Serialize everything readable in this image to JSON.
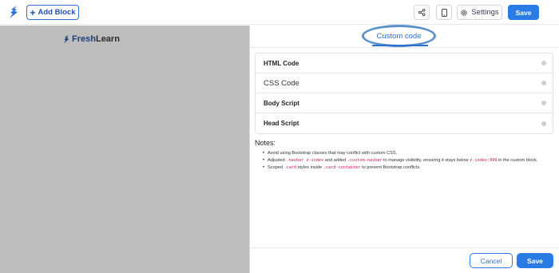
{
  "topbar": {
    "logo_icon": "freshlearn-logo-icon",
    "add_block_label": "Add Block",
    "share_icon": "share-icon",
    "mobile_icon": "mobile-icon",
    "settings_label": "Settings",
    "settings_icon": "gear-icon",
    "save_label": "Save"
  },
  "preview": {
    "brand_fresh": "Fresh",
    "brand_learn": "Learn"
  },
  "panel": {
    "title": "Custom code",
    "sections": [
      {
        "label": "HTML Code"
      },
      {
        "label": "CSS Code"
      },
      {
        "label": "Body Script"
      },
      {
        "label": "Head Script"
      }
    ],
    "notes_title": "Notes:",
    "notes": {
      "n1": "Avoid using Bootstrap classes that may conflict with custom CSS.",
      "n2_a": "Adjusted ",
      "n2_code1": ".navbar z-index",
      "n2_b": " and added ",
      "n2_code2": ".custom-navbar",
      "n2_c": " to manage visibility, ensuring it stays below ",
      "n2_code3": "z-index:999",
      "n2_d": " in the custom block.",
      "n3_a": "Scoped ",
      "n3_code1": ".card",
      "n3_b": " styles inside ",
      "n3_code2": ".card-container",
      "n3_c": " to prevent Bootstrap conflicts."
    },
    "cancel_label": "Cancel",
    "save_label": "Save"
  },
  "colors": {
    "accent": "#2b7be4",
    "preview_bg": "#bdbdbd",
    "brand": "#1d3f77",
    "code": "#c2185b"
  }
}
